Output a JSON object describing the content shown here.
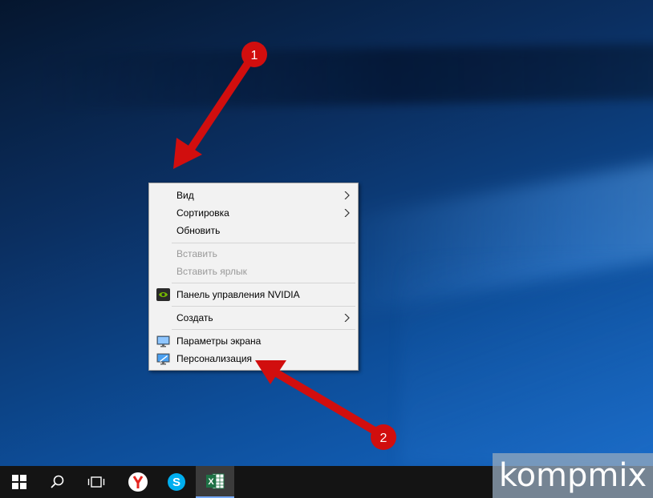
{
  "context_menu": {
    "items": [
      {
        "label": "Вид",
        "submenu": true
      },
      {
        "label": "Сортировка",
        "submenu": true
      },
      {
        "label": "Обновить",
        "submenu": false
      },
      {
        "label": "Вставить",
        "disabled": true
      },
      {
        "label": "Вставить ярлык",
        "disabled": true
      },
      {
        "label": "Панель управления NVIDIA",
        "icon": "nvidia-icon"
      },
      {
        "label": "Создать",
        "submenu": true
      },
      {
        "label": "Параметры экрана",
        "icon": "display-settings-icon"
      },
      {
        "label": "Персонализация",
        "icon": "personalization-icon"
      }
    ]
  },
  "annotations": {
    "badge1": "1",
    "badge2": "2",
    "color": "#d10e0e"
  },
  "taskbar": {
    "icons": [
      "windows-start-icon",
      "search-icon",
      "task-view-icon",
      "yandex-browser-icon",
      "skype-icon",
      "excel-icon"
    ]
  },
  "watermark": {
    "text": "kompmix"
  }
}
